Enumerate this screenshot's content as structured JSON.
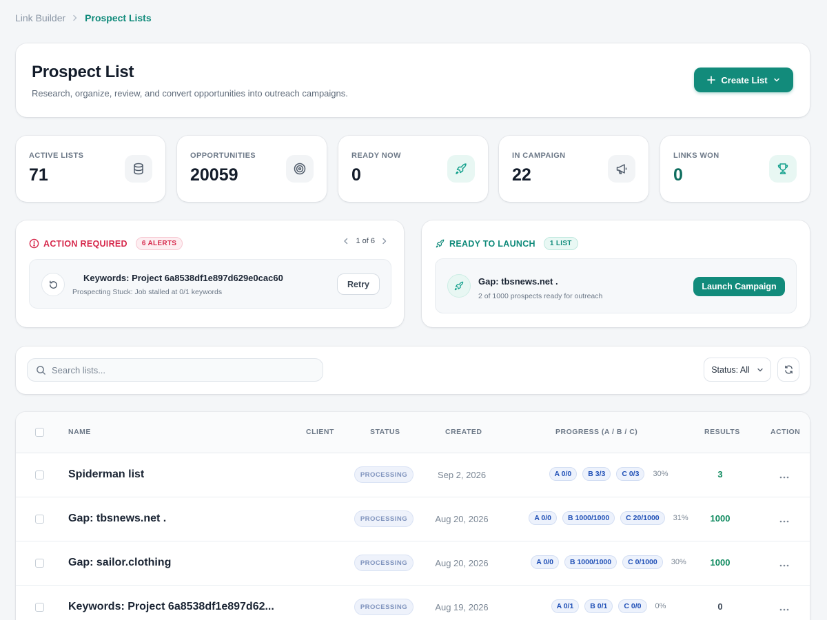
{
  "breadcrumb": {
    "parent": "Link Builder",
    "current": "Prospect Lists"
  },
  "header": {
    "title": "Prospect List",
    "subtitle": "Research, organize, review, and convert opportunities into outreach campaigns.",
    "create_label": "Create List"
  },
  "stats": [
    {
      "label": "ACTIVE LISTS",
      "value": "71",
      "icon": "database-icon"
    },
    {
      "label": "OPPORTUNITIES",
      "value": "20059",
      "icon": "target-icon"
    },
    {
      "label": "READY NOW",
      "value": "0",
      "icon": "rocket-icon"
    },
    {
      "label": "IN CAMPAIGN",
      "value": "22",
      "icon": "megaphone-icon"
    },
    {
      "label": "LINKS WON",
      "value": "0",
      "icon": "trophy-icon"
    }
  ],
  "alerts": {
    "title": "ACTION REQUIRED",
    "badge": "6 ALERTS",
    "pager": "1 of 6",
    "item": {
      "title": "Keywords: Project 6a8538df1e897d629e0cac60",
      "subtitle": "Prospecting Stuck: Job stalled at 0/1 keywords",
      "button": "Retry"
    }
  },
  "launch": {
    "title": "READY TO LAUNCH",
    "badge": "1 LIST",
    "item": {
      "title": "Gap: tbsnews.net .",
      "subtitle": "2 of 1000 prospects ready for outreach",
      "button": "Launch Campaign"
    }
  },
  "filters": {
    "search_placeholder": "Search lists...",
    "search_value": "",
    "status_label": "Status: All"
  },
  "table": {
    "columns": {
      "name": "NAME",
      "client": "CLIENT",
      "status": "STATUS",
      "created": "CREATED",
      "progress": "PROGRESS (A / B / C)",
      "results": "RESULTS",
      "action": "ACTION"
    },
    "rows": [
      {
        "name": "Spiderman list",
        "client": "",
        "status": "PROCESSING",
        "created": "Sep 2, 2026",
        "a": "A 0/0",
        "b": "B 3/3",
        "c": "C 0/3",
        "pct": "30%",
        "results": "3"
      },
      {
        "name": "Gap: tbsnews.net .",
        "client": "",
        "status": "PROCESSING",
        "created": "Aug 20, 2026",
        "a": "A 0/0",
        "b": "B 1000/1000",
        "c": "C 20/1000",
        "pct": "31%",
        "results": "1000"
      },
      {
        "name": "Gap: sailor.clothing",
        "client": "",
        "status": "PROCESSING",
        "created": "Aug 20, 2026",
        "a": "A 0/0",
        "b": "B 1000/1000",
        "c": "C 0/1000",
        "pct": "30%",
        "results": "1000"
      },
      {
        "name": "Keywords: Project 6a8538df1e897d62...",
        "client": "",
        "status": "PROCESSING",
        "created": "Aug 19, 2026",
        "a": "A 0/1",
        "b": "B 0/1",
        "c": "C 0/0",
        "pct": "0%",
        "results": "0"
      }
    ]
  }
}
